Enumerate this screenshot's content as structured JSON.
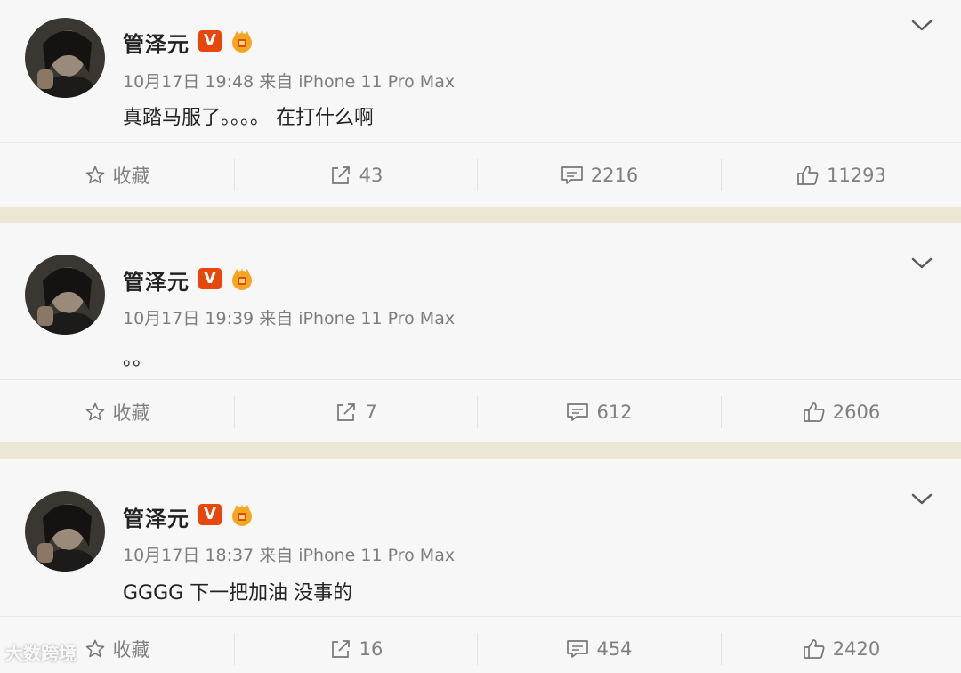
{
  "posts": [
    {
      "username": "管泽元",
      "verified_badge": "V",
      "meta": "10月17日 19:48 来自 iPhone 11 Pro Max",
      "content": "真踏马服了。。。。 在打什么啊",
      "actions": {
        "favorite": "收藏",
        "repost": "43",
        "comment": "2216",
        "like": "11293"
      }
    },
    {
      "username": "管泽元",
      "verified_badge": "V",
      "meta": "10月17日 19:39 来自 iPhone 11 Pro Max",
      "content": "。。",
      "actions": {
        "favorite": "收藏",
        "repost": "7",
        "comment": "612",
        "like": "2606"
      }
    },
    {
      "username": "管泽元",
      "verified_badge": "V",
      "meta": "10月17日 18:37 来自 iPhone 11 Pro Max",
      "content": "GGGG 下一把加油 没事的",
      "actions": {
        "favorite": "收藏",
        "repost": "16",
        "comment": "454",
        "like": "2420"
      }
    }
  ],
  "icons": {
    "favorite": "star-outline-icon",
    "repost": "share-arrow-icon",
    "comment": "comment-bubble-icon",
    "like": "thumbs-up-icon",
    "more": "chevron-down-icon"
  },
  "colors": {
    "verified_badge": "#e8470c",
    "crown_badge": "#f5a623",
    "card_background": "#f7f7f7",
    "separator_band": "#ece7d4"
  },
  "watermark": "大数跨境"
}
